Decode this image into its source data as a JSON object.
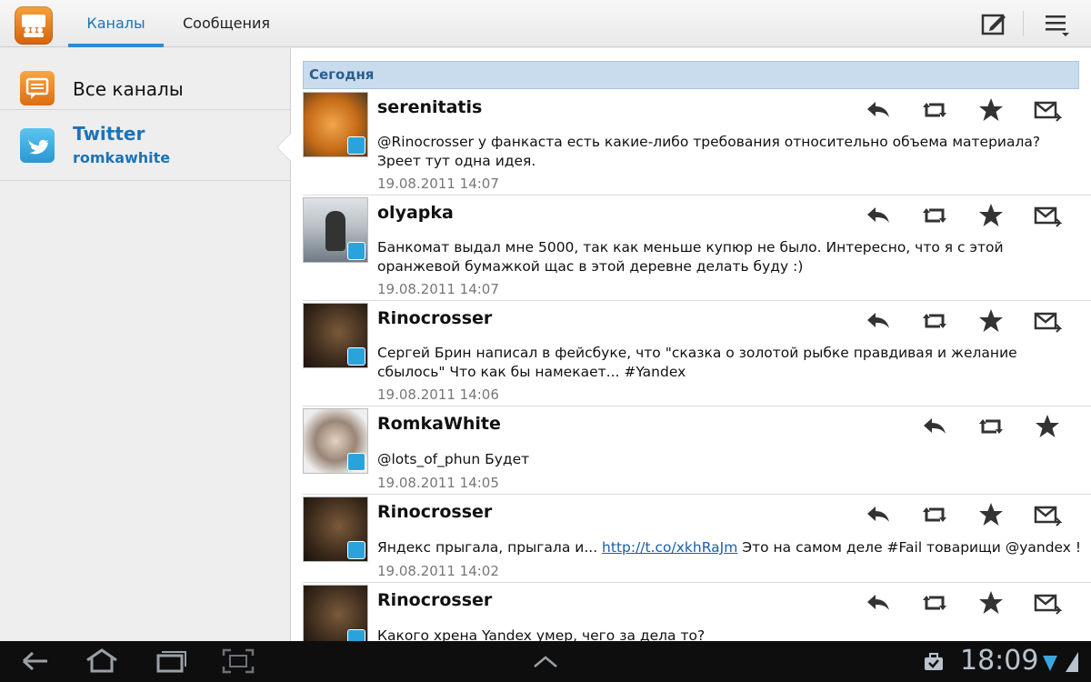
{
  "app": {
    "tabs": [
      {
        "label": "Каналы",
        "active": true
      },
      {
        "label": "Сообщения",
        "active": false
      }
    ],
    "accent_color": "#2f8bd2"
  },
  "sidebar": {
    "items": [
      {
        "label": "Все каналы",
        "icon": "message-icon"
      },
      {
        "label": "Twitter",
        "sub": "romkawhite",
        "icon": "twitter-icon"
      }
    ]
  },
  "feed": {
    "section": "Сегодня",
    "tweets": [
      {
        "author": "serenitatis",
        "text": "@Rinocrosser у фанкаста есть какие-либо требования относительно объема материала? Зреет тут одна идея.",
        "time": "19.08.2011 14:07"
      },
      {
        "author": "olyapka",
        "text": "Банкомат выдал мне 5000, так как меньше купюр не было. Интересно, что я с этой оранжевой бумажкой щас в этой деревне делать буду :)",
        "time": "19.08.2011 14:07"
      },
      {
        "author": "Rinocrosser",
        "text": "Сергей Брин написал в фейсбуке, что \"сказка о золотой рыбке правдивая и желание сбылось\" Что как бы намекает... #Yandex",
        "time": "19.08.2011 14:06"
      },
      {
        "author": "RomkaWhite",
        "text": "@lots_of_phun Будет",
        "time": "19.08.2011 14:05"
      },
      {
        "author": "Rinocrosser",
        "text_before": "Яндекс прыгала, прыгала и... ",
        "link": "http://t.co/xkhRaJm",
        "text_after": " Это на самом деле #Fail товарищи @yandex !",
        "time": "19.08.2011 14:02"
      },
      {
        "author": "Rinocrosser",
        "text": "Какого хрена Yandex умер, чего за дела то?",
        "time": ""
      }
    ]
  },
  "status": {
    "clock": "18:09"
  }
}
